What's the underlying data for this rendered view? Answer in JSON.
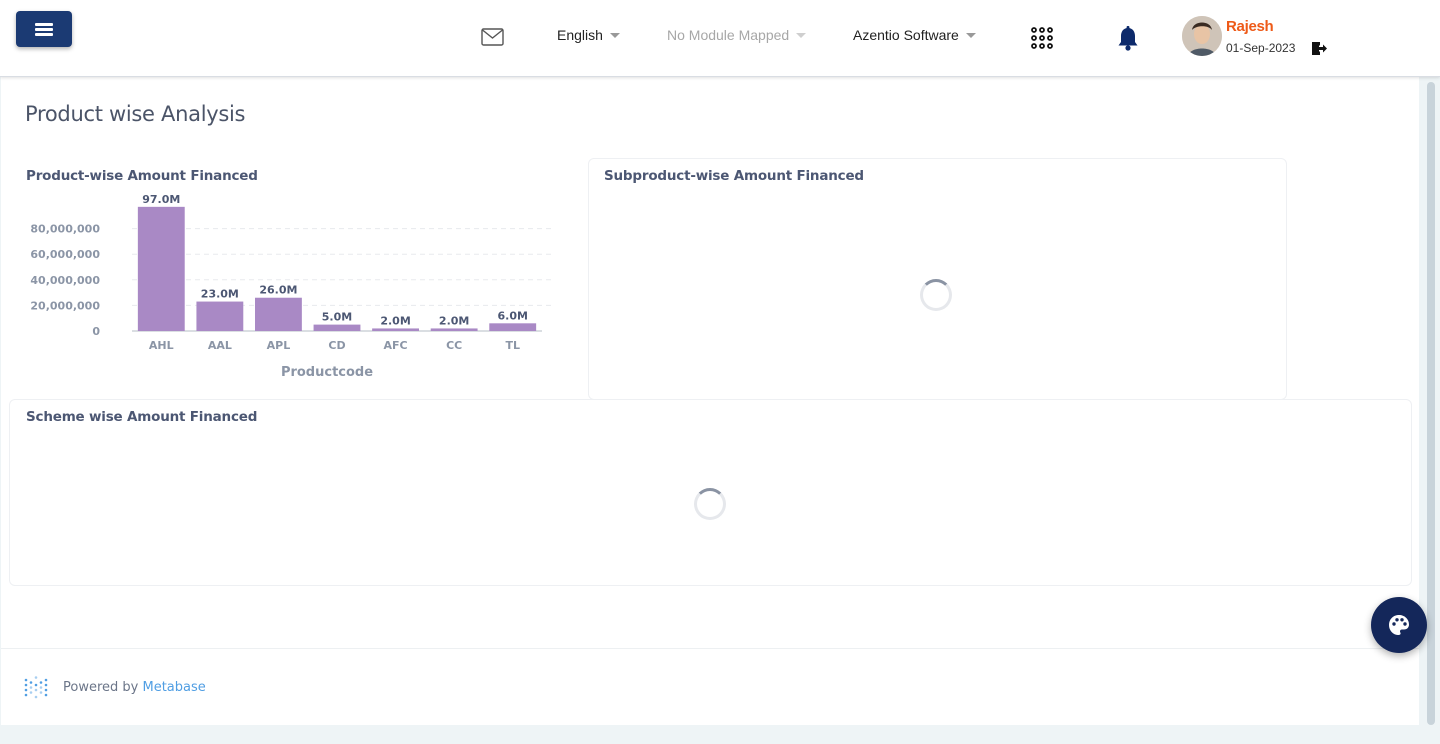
{
  "header": {
    "language": "English",
    "module": "No Module Mapped",
    "company": "Azentio Software",
    "user_name": "Rajesh",
    "user_date": "01-Sep-2023"
  },
  "page": {
    "title": "Product wise Analysis"
  },
  "cards": {
    "product": {
      "title": "Product-wise Amount Financed"
    },
    "subproduct": {
      "title": "Subproduct-wise Amount Financed"
    },
    "scheme": {
      "title": "Scheme wise Amount Financed"
    }
  },
  "footer": {
    "powered_prefix": "Powered by",
    "powered_brand": "Metabase"
  },
  "colors": {
    "bar": "#a989c5",
    "accent": "#1b3a73",
    "user": "#ee5a18"
  },
  "icons": [
    "menu-icon",
    "mail-icon",
    "apps-grid-icon",
    "bell-icon",
    "logout-icon",
    "palette-icon",
    "metabase-logo-icon"
  ],
  "chart_data": {
    "type": "bar",
    "title": "Product-wise Amount Financed",
    "xlabel": "Productcode",
    "ylabel": "",
    "categories": [
      "AHL",
      "AAL",
      "APL",
      "CD",
      "AFC",
      "CC",
      "TL"
    ],
    "values": [
      97000000,
      23000000,
      26000000,
      5000000,
      2000000,
      2000000,
      6000000
    ],
    "data_labels": [
      "97.0M",
      "23.0M",
      "26.0M",
      "5.0M",
      "2.0M",
      "2.0M",
      "6.0M"
    ],
    "yticks": [
      0,
      20000000,
      40000000,
      60000000,
      80000000
    ],
    "ytick_labels": [
      "0",
      "20,000,000",
      "40,000,000",
      "60,000,000",
      "80,000,000"
    ],
    "ylim": [
      0,
      100000000
    ],
    "grid": true
  }
}
